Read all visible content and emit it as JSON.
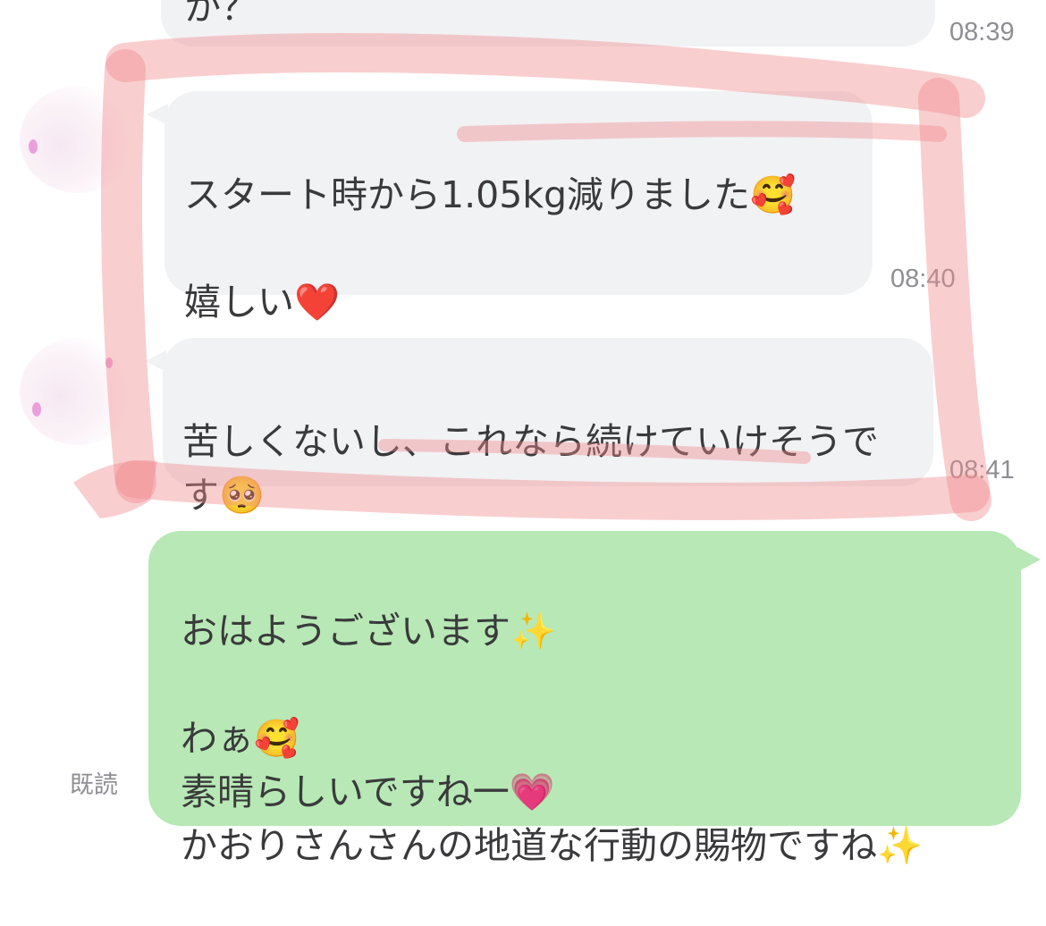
{
  "colors": {
    "incoming_bubble": "#f1f2f4",
    "outgoing_bubble": "#b7e8b5",
    "highlight": "#f08a8c",
    "timestamp": "#8e8e93"
  },
  "messages": [
    {
      "direction": "incoming",
      "text": "か？",
      "time": "08:39"
    },
    {
      "direction": "incoming",
      "text": "スタート時から1.05kg減りました🥰\n\n嬉しい❤️",
      "time": "08:40"
    },
    {
      "direction": "incoming",
      "text": "苦しくないし、これなら続けていけそうです🥺",
      "time": "08:41"
    },
    {
      "direction": "outgoing",
      "text": "おはようございます✨\n\nわぁ🥰\n素晴らしいですね一💗\nかおりさんさんの地道な行動の賜物ですね✨",
      "read_status": "既読"
    }
  ],
  "icons": {
    "avatar_1": "avatar",
    "avatar_2": "avatar",
    "highlight_mark": "hand-drawn-highlight"
  }
}
